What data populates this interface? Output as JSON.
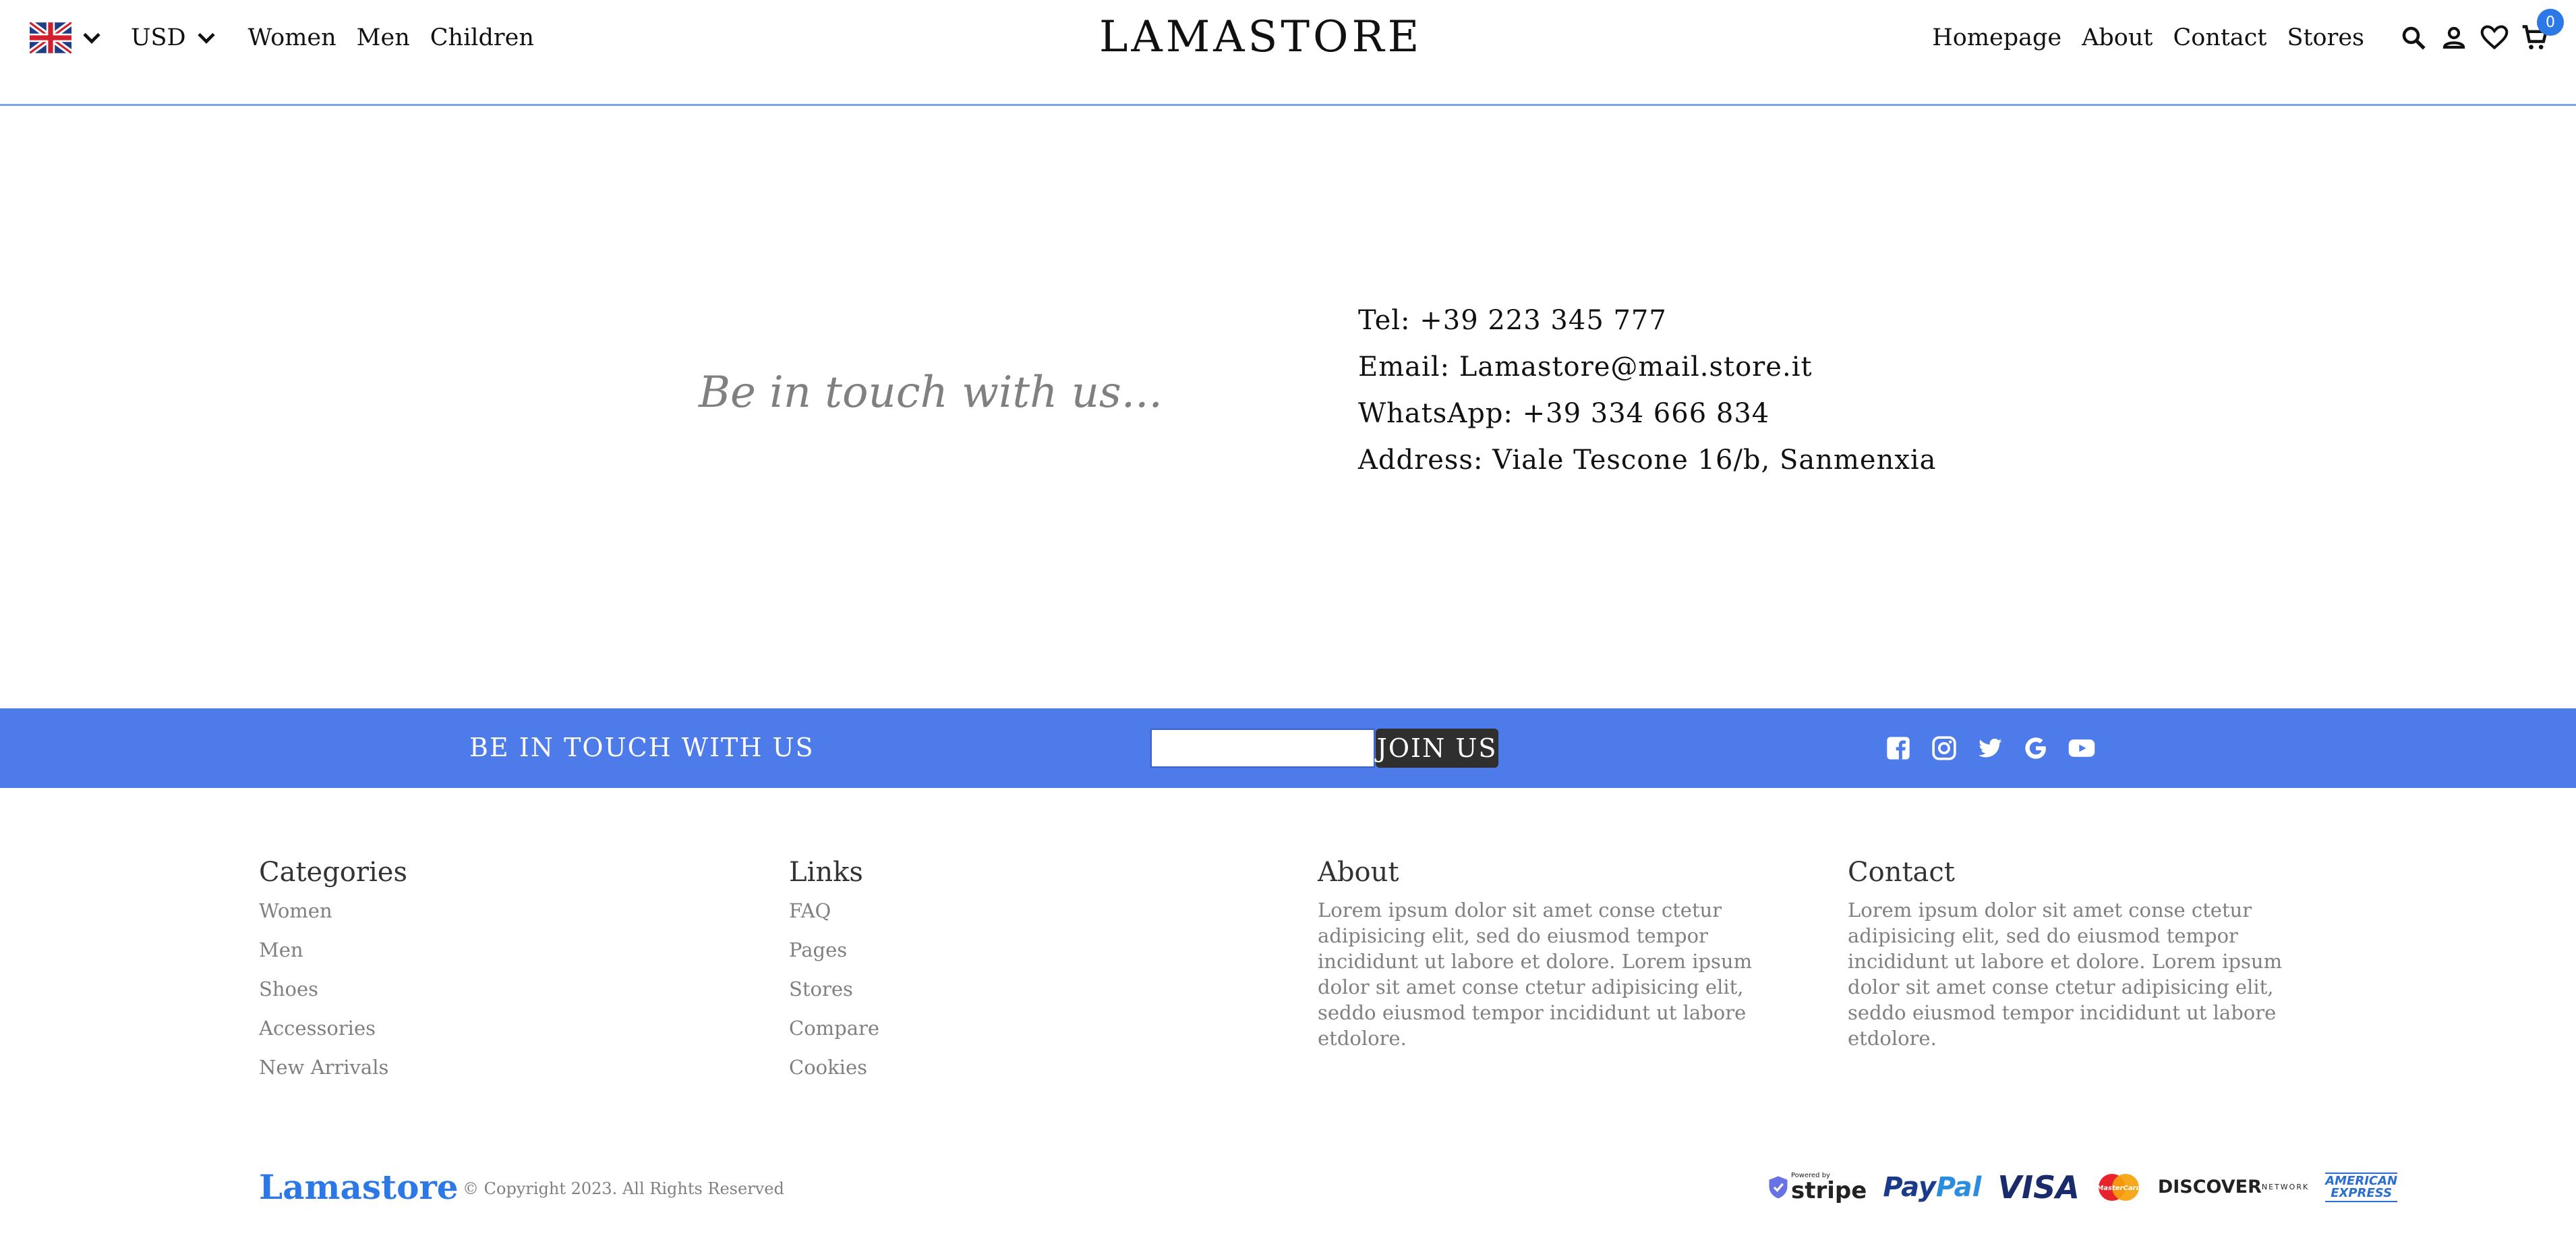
{
  "header": {
    "language_icon": "uk-flag-icon",
    "currency": "USD",
    "left_links": [
      "Women",
      "Men",
      "Children"
    ],
    "logo": "LAMASTORE",
    "right_links": [
      "Homepage",
      "About",
      "Contact",
      "Stores"
    ],
    "cart_count": "0"
  },
  "contact": {
    "tagline": "Be in touch with us...",
    "tel": "Tel: +39 223 345 777",
    "email": "Email: Lamastore@mail.store.it",
    "whatsapp": "WhatsApp: +39 334 666 834",
    "address": "Address: Viale Tescone 16/b, Sanmenxia"
  },
  "newsletter": {
    "title": "BE IN TOUCH WITH US",
    "input_value": "",
    "button_label": "JOIN US",
    "socials": [
      "facebook-icon",
      "instagram-icon",
      "twitter-icon",
      "google-icon",
      "youtube-icon"
    ]
  },
  "footer": {
    "categories": {
      "title": "Categories",
      "items": [
        "Women",
        "Men",
        "Shoes",
        "Accessories",
        "New Arrivals"
      ]
    },
    "links": {
      "title": "Links",
      "items": [
        "FAQ",
        "Pages",
        "Stores",
        "Compare",
        "Cookies"
      ]
    },
    "about": {
      "title": "About",
      "text": "Lorem ipsum dolor sit amet conse ctetur adipisicing elit, sed do eiusmod tempor incididunt ut labore et dolore. Lorem ipsum dolor sit amet conse ctetur adipisicing elit, seddo eiusmod tempor incididunt ut labore etdolore."
    },
    "contact": {
      "title": "Contact",
      "text": "Lorem ipsum dolor sit amet conse ctetur adipisicing elit, sed do eiusmod tempor incididunt ut labore et dolore. Lorem ipsum dolor sit amet conse ctetur adipisicing elit, seddo eiusmod tempor incididunt ut labore etdolore."
    },
    "brand": "Lamastore",
    "copyright": "© Copyright 2023. All Rights Reserved",
    "payments": {
      "stripe_powered": "Powered by",
      "stripe": "stripe",
      "paypal_pay": "Pay",
      "paypal_pal": "Pal",
      "visa": "VISA",
      "mastercard": "MasterCard",
      "discover": "DISCOVER",
      "discover_sub": "NETWORK",
      "amex_top": "AMERICAN",
      "amex_bottom": "EXPRESS"
    }
  },
  "colors": {
    "accent": "#4e7bea",
    "brand": "#2c78e6",
    "muted_text": "#808080",
    "button_dark": "#2f2f2f"
  }
}
